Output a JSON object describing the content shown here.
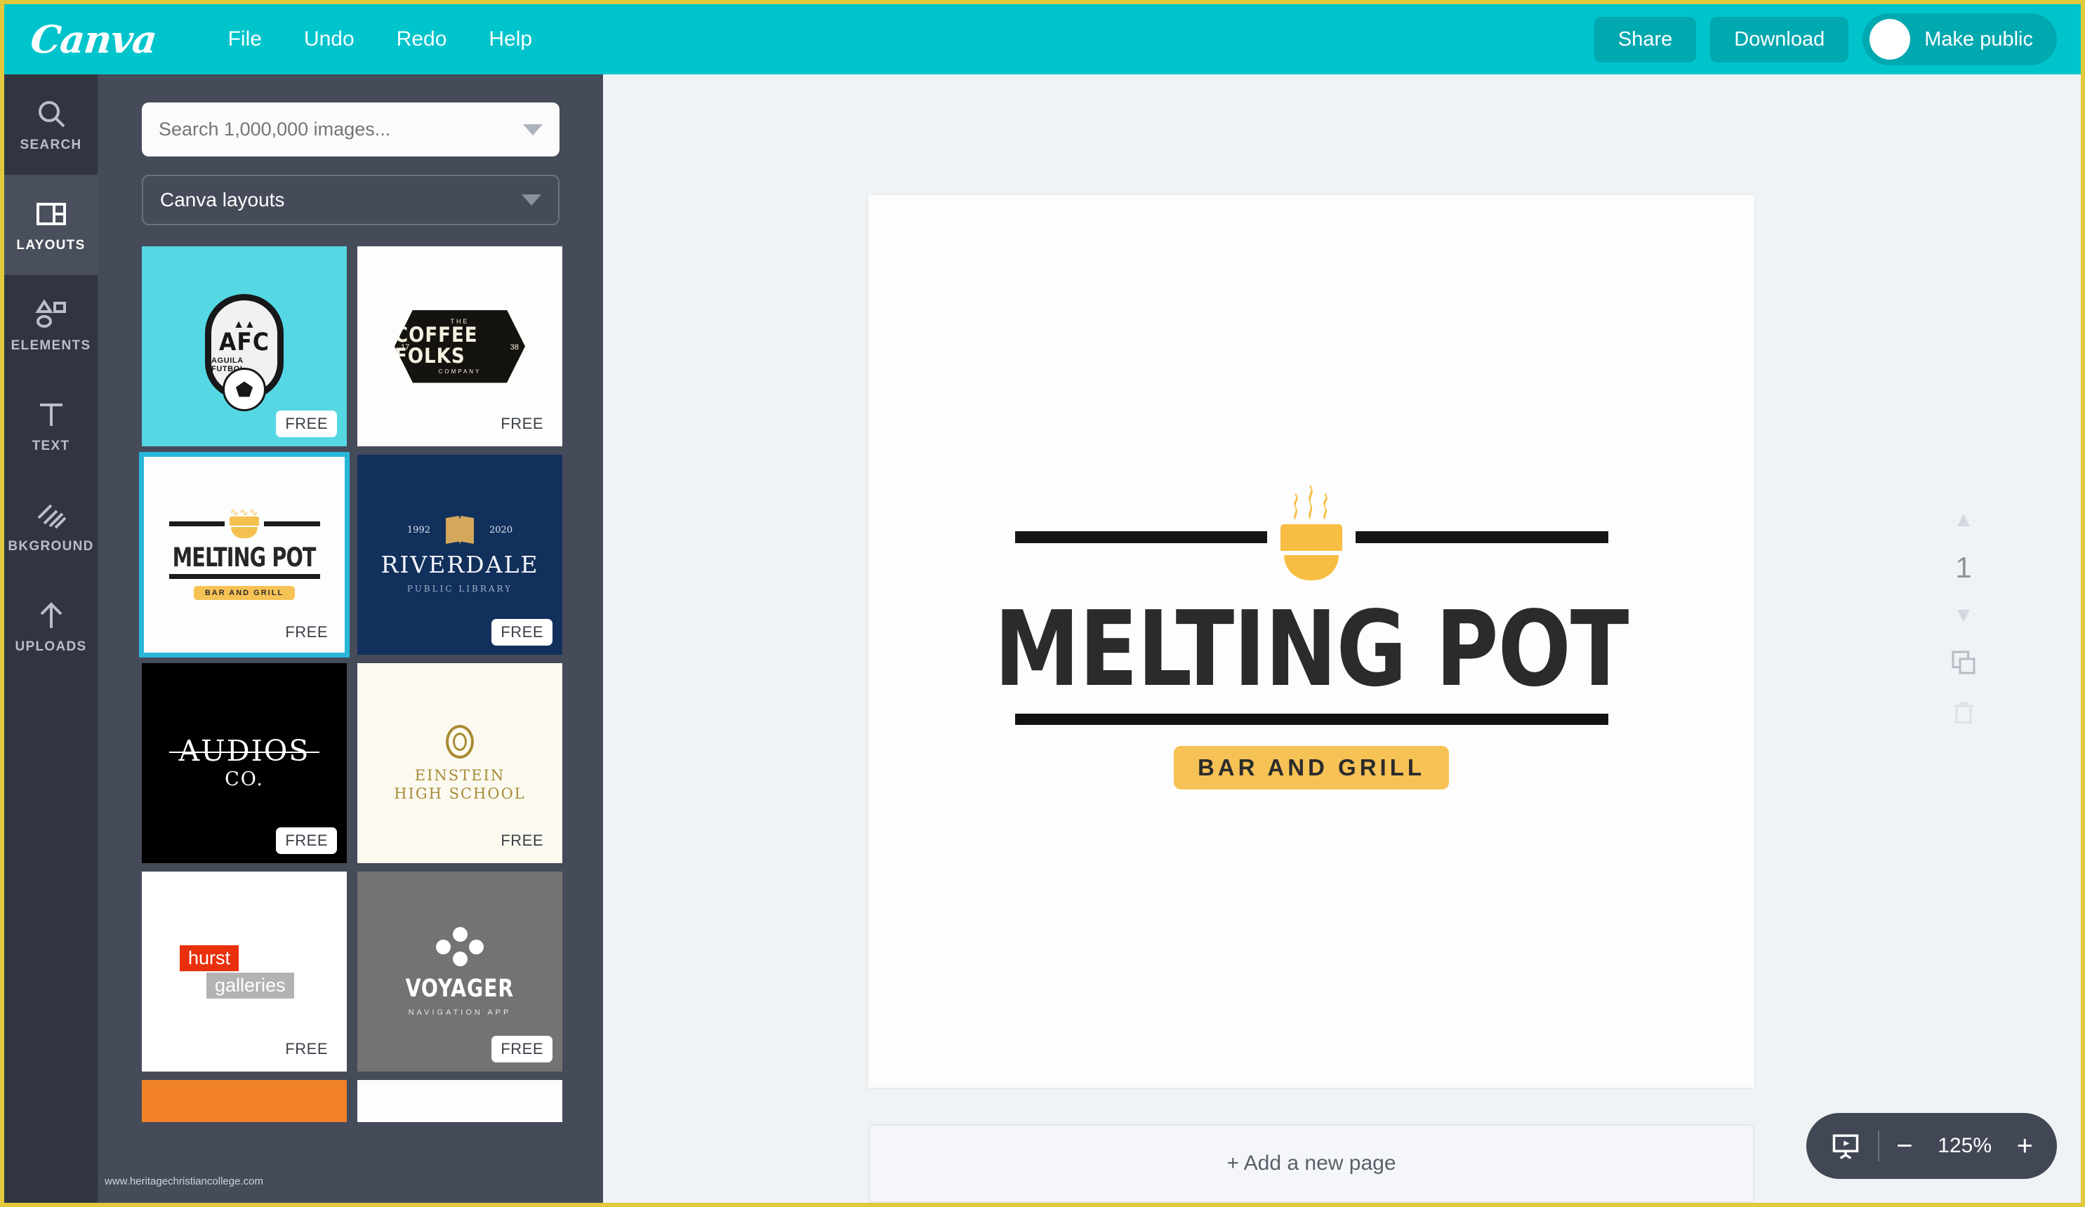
{
  "header": {
    "brand": "Canva",
    "menu": [
      {
        "label": "File"
      },
      {
        "label": "Undo"
      },
      {
        "label": "Redo"
      },
      {
        "label": "Help"
      }
    ],
    "share_label": "Share",
    "download_label": "Download",
    "make_public_label": "Make public",
    "bg_color": "#00c4cc",
    "button_color": "#00a8b0"
  },
  "rail": {
    "items": [
      {
        "label": "SEARCH",
        "icon": "search-icon",
        "active": false
      },
      {
        "label": "LAYOUTS",
        "icon": "layouts-icon",
        "active": true
      },
      {
        "label": "ELEMENTS",
        "icon": "elements-icon",
        "active": false
      },
      {
        "label": "TEXT",
        "icon": "text-icon",
        "active": false
      },
      {
        "label": "BKGROUND",
        "icon": "background-icon",
        "active": false
      },
      {
        "label": "UPLOADS",
        "icon": "uploads-icon",
        "active": false
      }
    ]
  },
  "panel": {
    "search_placeholder": "Search 1,000,000 images...",
    "search_value": "",
    "category_selected": "Canva layouts",
    "free_badge": "FREE",
    "thumbnails": [
      {
        "id": "afc",
        "title": "AFC",
        "subtitle": "AGUILA FUTBOL",
        "badge": "FREE",
        "selected": false,
        "bg": "#55d7e4"
      },
      {
        "id": "coffee",
        "title": "COFFEE FOLKS",
        "subtitle": "COMPANY",
        "badge": "FREE",
        "selected": false,
        "bg": "#fdfdfb",
        "the": "THE",
        "year_left": "17",
        "year_right": "38"
      },
      {
        "id": "meltingpot",
        "title": "MELTING POT",
        "subtitle": "BAR AND GRILL",
        "badge": "FREE",
        "selected": true,
        "bg": "#fdfdfd"
      },
      {
        "id": "riverdale",
        "title": "RIVERDALE",
        "subtitle": "PUBLIC LIBRARY",
        "badge": "FREE",
        "selected": false,
        "bg": "#12305c",
        "year_left": "1992",
        "year_right": "2020"
      },
      {
        "id": "audios",
        "title": "AUDIOS",
        "subtitle": "CO.",
        "badge": "FREE",
        "selected": false,
        "bg": "#000000"
      },
      {
        "id": "einstein",
        "title": "EINSTEIN",
        "subtitle": "HIGH SCHOOL",
        "badge": "FREE",
        "selected": false,
        "bg": "#fcfaf0"
      },
      {
        "id": "hurst",
        "title": "hurst",
        "subtitle": "galleries",
        "badge": "FREE",
        "selected": false,
        "bg": "#ffffff"
      },
      {
        "id": "voyager",
        "title": "VOYAGER",
        "subtitle": "NAVIGATION APP",
        "badge": "FREE",
        "selected": false,
        "bg": "#737373"
      },
      {
        "id": "orange",
        "title": "",
        "subtitle": "",
        "badge": "",
        "selected": false,
        "bg": "#f08127"
      },
      {
        "id": "blank",
        "title": "",
        "subtitle": "",
        "badge": "",
        "selected": false,
        "bg": "#fdfdfd"
      }
    ],
    "watermark": "www.heritagechristiancollege.com"
  },
  "canvas": {
    "logo": {
      "title": "MELTING POT",
      "tagline": "BAR AND GRILL",
      "accent_color": "#f7c255",
      "bar_color": "#161616",
      "text_color": "#2b2b2b"
    },
    "page_tools": {
      "page_number": "1",
      "up_chevron": "▲",
      "down_chevron": "▼",
      "duplicate_icon": "duplicate-icon",
      "delete_icon": "trash-icon"
    },
    "add_page_label": "+ Add a new page"
  },
  "zoom": {
    "present_icon": "present-icon",
    "minus_label": "−",
    "value": "125%",
    "plus_label": "+"
  }
}
